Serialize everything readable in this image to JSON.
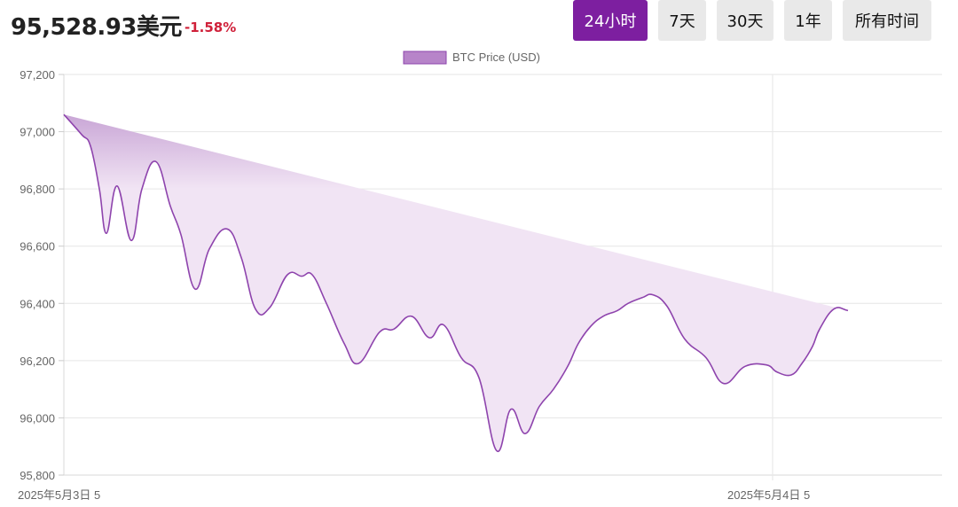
{
  "header": {
    "price": "95,528.93美元",
    "change": "-1.58%"
  },
  "ranges": [
    {
      "label": "24小时",
      "active": true
    },
    {
      "label": "7天",
      "active": false
    },
    {
      "label": "30天",
      "active": false
    },
    {
      "label": "1年",
      "active": false
    },
    {
      "label": "所有时间",
      "active": false
    }
  ],
  "colors": {
    "line": "#8e44ad",
    "fill": "#f1e4f4",
    "fill_top": "#c9a6d6",
    "legend_fill": "#b784c9",
    "negative": "#d0213a",
    "active_button": "#7d1fa0"
  },
  "chart_data": {
    "type": "area",
    "legend": "BTC Price (USD)",
    "legend_position": "top-center",
    "ylim": [
      95800,
      97200
    ],
    "yticks": [
      95800,
      96000,
      96200,
      96400,
      96600,
      96800,
      97000,
      97200
    ],
    "ytick_labels": [
      "95,800",
      "96,000",
      "96,200",
      "96,400",
      "96,600",
      "96,800",
      "97,000",
      "97,200"
    ],
    "xtick_labels": [
      "2025年5月3日 5",
      "2025年5月4日 5"
    ],
    "grid": true,
    "x": [
      0,
      0.5,
      0.75,
      1,
      1.2,
      1.5,
      1.9,
      2.2,
      2.6,
      3.0,
      3.3,
      3.7,
      4.1,
      4.6,
      5.0,
      5.4,
      5.8,
      6.3,
      6.7,
      7.0,
      7.4,
      7.9,
      8.3,
      8.9,
      9.3,
      9.8,
      10.3,
      10.7,
      11.2,
      11.7,
      12.2,
      12.6,
      13.0,
      13.4,
      13.8,
      14.2,
      14.5,
      14.85,
      15.2,
      15.6,
      15.9,
      16.3,
      16.6,
      17.0,
      17.5,
      18.1,
      18.6,
      19.2,
      19.8,
      20.1,
      20.5,
      20.8,
      21.1,
      21.3,
      21.7,
      22.1,
      22.6,
      23.0,
      23.3,
      23.6,
      24.0,
      24.4,
      24.75
    ],
    "y": [
      97060,
      96990,
      96950,
      96800,
      96645,
      96810,
      96620,
      96800,
      96895,
      96740,
      96640,
      96450,
      96590,
      96660,
      96560,
      96380,
      96385,
      96500,
      96495,
      96500,
      96400,
      96260,
      96190,
      96300,
      96310,
      96355,
      96280,
      96325,
      96210,
      96140,
      95885,
      96030,
      95945,
      96040,
      96100,
      96180,
      96260,
      96320,
      96355,
      96375,
      96400,
      96420,
      96430,
      96390,
      96275,
      96210,
      96120,
      96180,
      96185,
      96160,
      96150,
      96190,
      96250,
      96310,
      96380,
      96375,
      96360
    ]
  }
}
